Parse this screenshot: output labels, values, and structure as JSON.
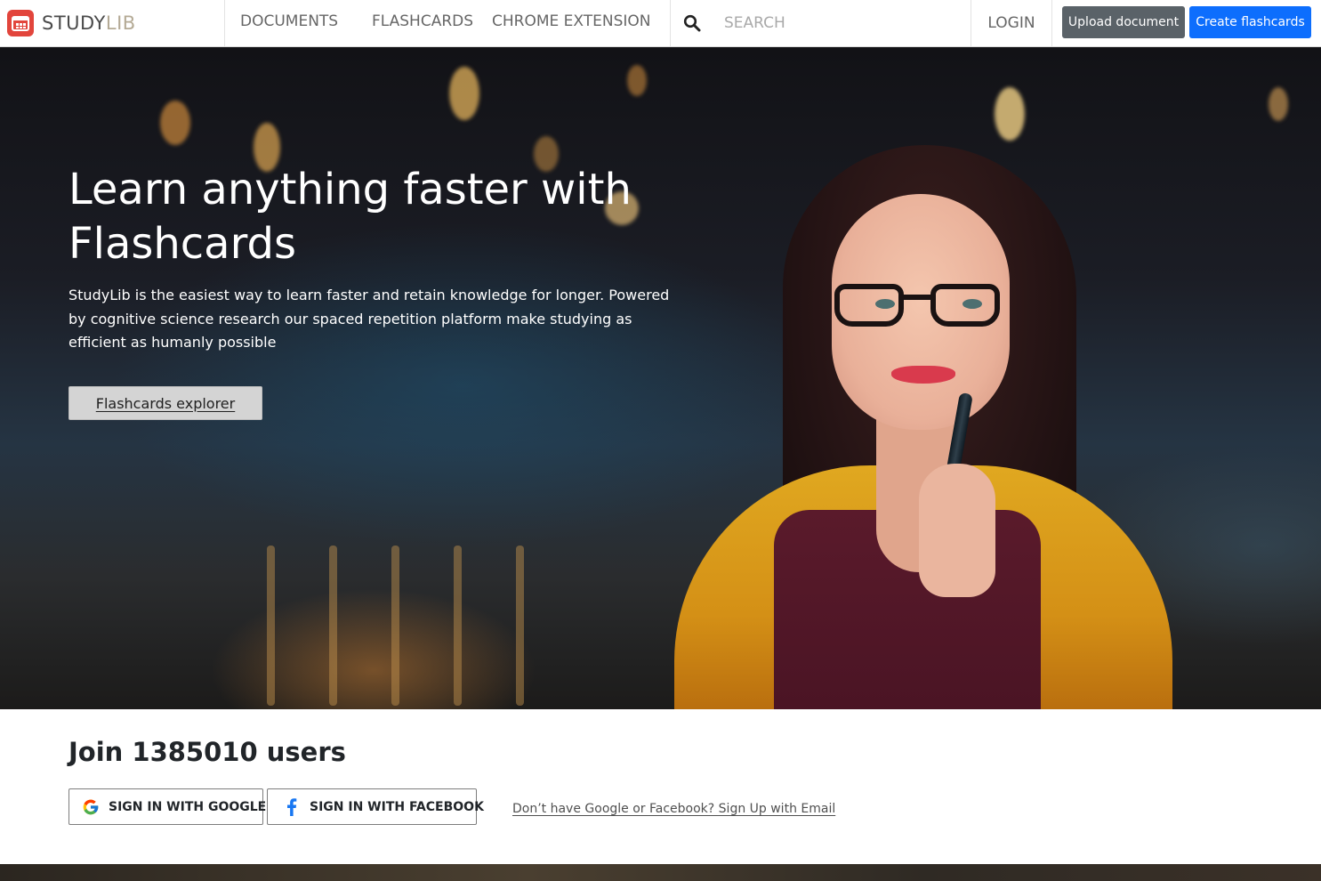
{
  "brand": {
    "part1": "STUDY",
    "part2": "LIB"
  },
  "nav": {
    "links": [
      {
        "label": "DOCUMENTS"
      },
      {
        "label": "FLASHCARDS"
      },
      {
        "label": "CHROME EXTENSION"
      }
    ],
    "search_placeholder": "SEARCH",
    "login_label": "LOGIN",
    "upload_label": "Upload document",
    "create_label": "Create flashcards"
  },
  "hero": {
    "title": "Learn anything faster with Flashcards",
    "description": "StudyLib is the easiest way to learn faster and retain knowledge for longer. Powered by cognitive science research our spaced repetition platform make studying as efficient as humanly possible",
    "button_label": "Flashcards explorer"
  },
  "join": {
    "title": "Join 1385010 users",
    "google_label": "SIGN IN WITH GOOGLE",
    "facebook_label": "SIGN IN WITH FACEBOOK",
    "email_link": "Don’t have Google or Facebook? Sign Up with Email"
  },
  "colors": {
    "brand_red": "#e2453c",
    "upload_button": "#5a6268",
    "create_button": "#0d6efd",
    "facebook_blue": "#1877f2"
  }
}
